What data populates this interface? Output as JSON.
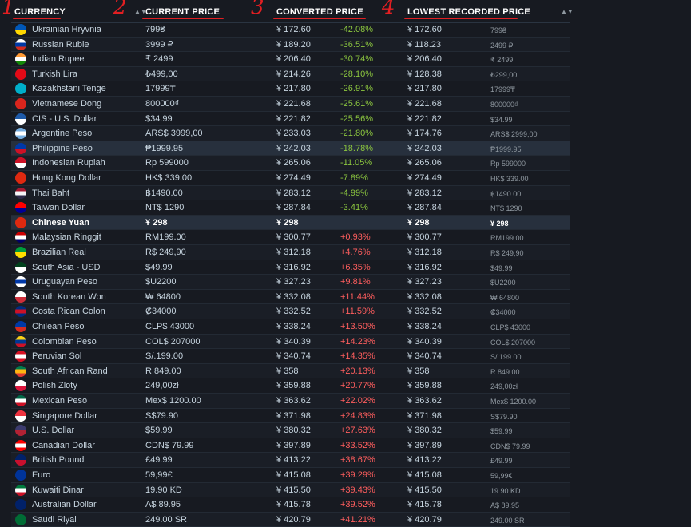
{
  "header": {
    "currency": "CURRENCY",
    "current_price": "CURRENT PRICE",
    "converted_price": "CONVERTED PRICE",
    "lowest_price": "LOWEST RECORDED PRICE",
    "annotations": [
      "1",
      "2",
      "3",
      "4"
    ],
    "sort_icon": "sort-arrows-icon"
  },
  "colors": {
    "positive": "#ff5e5e",
    "negative": "#8bc53f",
    "annotation": "#e21f22"
  },
  "rows": [
    {
      "name": "Ukrainian Hryvnia",
      "current": "799₴",
      "converted": "¥ 172.60",
      "diff": "-42.08%",
      "lowest": "¥ 172.60",
      "lowest_orig": "799₴",
      "flag": [
        "#0057b7",
        "#ffd700"
      ]
    },
    {
      "name": "Russian Ruble",
      "current": "3999 ₽",
      "converted": "¥ 189.20",
      "diff": "-36.51%",
      "lowest": "¥ 118.23",
      "lowest_orig": "2499 ₽",
      "flag": [
        "#ffffff",
        "#0039a6",
        "#d52b1e"
      ]
    },
    {
      "name": "Indian Rupee",
      "current": "₹ 2499",
      "converted": "¥ 206.40",
      "diff": "-30.74%",
      "lowest": "¥ 206.40",
      "lowest_orig": "₹ 2499",
      "flag": [
        "#ff9933",
        "#ffffff",
        "#138808"
      ]
    },
    {
      "name": "Turkish Lira",
      "current": "₺499,00",
      "converted": "¥ 214.26",
      "diff": "-28.10%",
      "lowest": "¥ 128.38",
      "lowest_orig": "₺299,00",
      "flag": [
        "#e30a17",
        "#e30a17"
      ]
    },
    {
      "name": "Kazakhstani Tenge",
      "current": "17999₸",
      "converted": "¥ 217.80",
      "diff": "-26.91%",
      "lowest": "¥ 217.80",
      "lowest_orig": "17999₸",
      "flag": [
        "#00afca",
        "#00afca"
      ]
    },
    {
      "name": "Vietnamese Dong",
      "current": "800000₫",
      "converted": "¥ 221.68",
      "diff": "-25.61%",
      "lowest": "¥ 221.68",
      "lowest_orig": "800000₫",
      "flag": [
        "#da251d",
        "#da251d"
      ]
    },
    {
      "name": "CIS - U.S. Dollar",
      "current": "$34.99",
      "converted": "¥ 221.82",
      "diff": "-25.56%",
      "lowest": "¥ 221.82",
      "lowest_orig": "$34.99",
      "flag": [
        "#1e5aa8",
        "#ffffff"
      ]
    },
    {
      "name": "Argentine Peso",
      "current": "ARS$ 3999,00",
      "converted": "¥ 233.03",
      "diff": "-21.80%",
      "lowest": "¥ 174.76",
      "lowest_orig": "ARS$ 2999,00",
      "flag": [
        "#74acdf",
        "#ffffff",
        "#74acdf"
      ]
    },
    {
      "name": "Philippine Peso",
      "current": "₱1999.95",
      "converted": "¥ 242.03",
      "diff": "-18.78%",
      "lowest": "¥ 242.03",
      "lowest_orig": "₱1999.95",
      "flag": [
        "#0038a8",
        "#ce1126"
      ]
    },
    {
      "name": "Indonesian Rupiah",
      "current": "Rp 599000",
      "converted": "¥ 265.06",
      "diff": "-11.05%",
      "lowest": "¥ 265.06",
      "lowest_orig": "Rp 599000",
      "flag": [
        "#ce1126",
        "#ffffff"
      ]
    },
    {
      "name": "Hong Kong Dollar",
      "current": "HK$ 339.00",
      "converted": "¥ 274.49",
      "diff": "-7.89%",
      "lowest": "¥ 274.49",
      "lowest_orig": "HK$ 339.00",
      "flag": [
        "#de2910",
        "#de2910"
      ]
    },
    {
      "name": "Thai Baht",
      "current": "฿1490.00",
      "converted": "¥ 283.12",
      "diff": "-4.99%",
      "lowest": "¥ 283.12",
      "lowest_orig": "฿1490.00",
      "flag": [
        "#a51931",
        "#f4f5f8",
        "#2d2a4a"
      ]
    },
    {
      "name": "Taiwan Dollar",
      "current": "NT$ 1290",
      "converted": "¥ 287.84",
      "diff": "-3.41%",
      "lowest": "¥ 287.84",
      "lowest_orig": "NT$ 1290",
      "flag": [
        "#fe0000",
        "#000095"
      ]
    },
    {
      "name": "Chinese Yuan",
      "current": "¥ 298",
      "converted": "¥ 298",
      "diff": "",
      "lowest": "¥ 298",
      "lowest_orig": "¥ 298",
      "flag": [
        "#de2910",
        "#de2910"
      ]
    },
    {
      "name": "Malaysian Ringgit",
      "current": "RM199.00",
      "converted": "¥ 300.77",
      "diff": "+0.93%",
      "lowest": "¥ 300.77",
      "lowest_orig": "RM199.00",
      "flag": [
        "#cc0001",
        "#ffffff",
        "#010066"
      ]
    },
    {
      "name": "Brazilian Real",
      "current": "R$ 249,90",
      "converted": "¥ 312.18",
      "diff": "+4.76%",
      "lowest": "¥ 312.18",
      "lowest_orig": "R$ 249,90",
      "flag": [
        "#009c3b",
        "#ffdf00"
      ]
    },
    {
      "name": "South Asia - USD",
      "current": "$49.99",
      "converted": "¥ 316.92",
      "diff": "+6.35%",
      "lowest": "¥ 316.92",
      "lowest_orig": "$49.99",
      "flag": [
        "#01411c",
        "#ffffff"
      ]
    },
    {
      "name": "Uruguayan Peso",
      "current": "$U2200",
      "converted": "¥ 327.23",
      "diff": "+9.81%",
      "lowest": "¥ 327.23",
      "lowest_orig": "$U2200",
      "flag": [
        "#ffffff",
        "#0038a8",
        "#ffffff"
      ]
    },
    {
      "name": "South Korean Won",
      "current": "₩ 64800",
      "converted": "¥ 332.08",
      "diff": "+11.44%",
      "lowest": "¥ 332.08",
      "lowest_orig": "₩ 64800",
      "flag": [
        "#ffffff",
        "#cd2e3a"
      ]
    },
    {
      "name": "Costa Rican Colon",
      "current": "₡34000",
      "converted": "¥ 332.52",
      "diff": "+11.59%",
      "lowest": "¥ 332.52",
      "lowest_orig": "₡34000",
      "flag": [
        "#002b7f",
        "#ce1126",
        "#002b7f"
      ]
    },
    {
      "name": "Chilean Peso",
      "current": "CLP$ 43000",
      "converted": "¥ 338.24",
      "diff": "+13.50%",
      "lowest": "¥ 338.24",
      "lowest_orig": "CLP$ 43000",
      "flag": [
        "#0039a6",
        "#d52b1e"
      ]
    },
    {
      "name": "Colombian Peso",
      "current": "COL$ 207000",
      "converted": "¥ 340.39",
      "diff": "+14.23%",
      "lowest": "¥ 340.39",
      "lowest_orig": "COL$ 207000",
      "flag": [
        "#fcd116",
        "#003893",
        "#ce1126"
      ]
    },
    {
      "name": "Peruvian Sol",
      "current": "S/.199.00",
      "converted": "¥ 340.74",
      "diff": "+14.35%",
      "lowest": "¥ 340.74",
      "lowest_orig": "S/.199.00",
      "flag": [
        "#d91023",
        "#ffffff",
        "#d91023"
      ]
    },
    {
      "name": "South African Rand",
      "current": "R 849.00",
      "converted": "¥ 358",
      "diff": "+20.13%",
      "lowest": "¥ 358",
      "lowest_orig": "R 849.00",
      "flag": [
        "#007a4d",
        "#ffb612",
        "#de3831"
      ]
    },
    {
      "name": "Polish Zloty",
      "current": "249,00zł",
      "converted": "¥ 359.88",
      "diff": "+20.77%",
      "lowest": "¥ 359.88",
      "lowest_orig": "249,00zł",
      "flag": [
        "#ffffff",
        "#dc143c"
      ]
    },
    {
      "name": "Mexican Peso",
      "current": "Mex$ 1200.00",
      "converted": "¥ 363.62",
      "diff": "+22.02%",
      "lowest": "¥ 363.62",
      "lowest_orig": "Mex$ 1200.00",
      "flag": [
        "#006847",
        "#ffffff",
        "#ce1126"
      ]
    },
    {
      "name": "Singapore Dollar",
      "current": "S$79.90",
      "converted": "¥ 371.98",
      "diff": "+24.83%",
      "lowest": "¥ 371.98",
      "lowest_orig": "S$79.90",
      "flag": [
        "#ef3340",
        "#ffffff"
      ]
    },
    {
      "name": "U.S. Dollar",
      "current": "$59.99",
      "converted": "¥ 380.32",
      "diff": "+27.63%",
      "lowest": "¥ 380.32",
      "lowest_orig": "$59.99",
      "flag": [
        "#3c3b6e",
        "#b22234"
      ]
    },
    {
      "name": "Canadian Dollar",
      "current": "CDN$ 79.99",
      "converted": "¥ 397.89",
      "diff": "+33.52%",
      "lowest": "¥ 397.89",
      "lowest_orig": "CDN$ 79.99",
      "flag": [
        "#ff0000",
        "#ffffff",
        "#ff0000"
      ]
    },
    {
      "name": "British Pound",
      "current": "£49.99",
      "converted": "¥ 413.22",
      "diff": "+38.67%",
      "lowest": "¥ 413.22",
      "lowest_orig": "£49.99",
      "flag": [
        "#012169",
        "#c8102e"
      ]
    },
    {
      "name": "Euro",
      "current": "59,99€",
      "converted": "¥ 415.08",
      "diff": "+39.29%",
      "lowest": "¥ 415.08",
      "lowest_orig": "59,99€",
      "flag": [
        "#003399",
        "#003399"
      ]
    },
    {
      "name": "Kuwaiti Dinar",
      "current": "19.90 KD",
      "converted": "¥ 415.50",
      "diff": "+39.43%",
      "lowest": "¥ 415.50",
      "lowest_orig": "19.90 KD",
      "flag": [
        "#007a3d",
        "#ffffff",
        "#ce1126"
      ]
    },
    {
      "name": "Australian Dollar",
      "current": "A$ 89.95",
      "converted": "¥ 415.78",
      "diff": "+39.52%",
      "lowest": "¥ 415.78",
      "lowest_orig": "A$ 89.95",
      "flag": [
        "#012169",
        "#012169"
      ]
    },
    {
      "name": "Saudi Riyal",
      "current": "249.00 SR",
      "converted": "¥ 420.79",
      "diff": "+41.21%",
      "lowest": "¥ 420.79",
      "lowest_orig": "249.00 SR",
      "flag": [
        "#006c35",
        "#006c35"
      ]
    }
  ]
}
